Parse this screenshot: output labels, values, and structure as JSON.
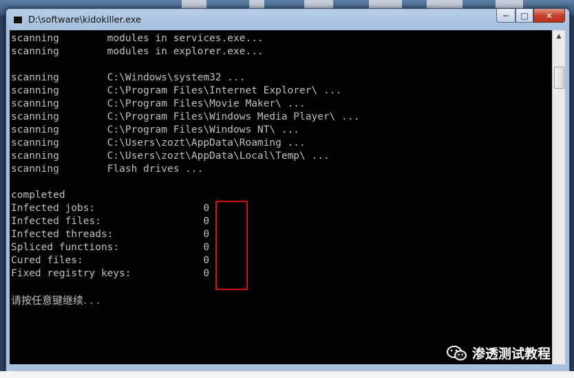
{
  "window": {
    "title": "D:\\software\\kidokiller.exe",
    "controls": {
      "minimize": "─",
      "maximize": "□",
      "close": "✕"
    }
  },
  "console": {
    "lines": [
      "scanning        modules in services.exe...",
      "scanning        modules in explorer.exe...",
      "",
      "scanning        C:\\Windows\\system32 ...",
      "scanning        C:\\Program Files\\Internet Explorer\\ ...",
      "scanning        C:\\Program Files\\Movie Maker\\ ...",
      "scanning        C:\\Program Files\\Windows Media Player\\ ...",
      "scanning        C:\\Program Files\\Windows NT\\ ...",
      "scanning        C:\\Users\\zozt\\AppData\\Roaming ...",
      "scanning        C:\\Users\\zozt\\AppData\\Local\\Temp\\ ...",
      "scanning        Flash drives ...",
      "",
      "completed",
      "Infected jobs:                  0",
      "Infected files:                 0",
      "Infected threads:               0",
      "Spliced functions:              0",
      "Cured files:                    0",
      "Fixed registry keys:            0",
      "",
      "请按任意键继续. . ."
    ]
  },
  "watermark": {
    "text": "渗透测试教程"
  },
  "colors": {
    "console_bg": "#000000",
    "console_fg": "#c0c0c0",
    "highlight": "#d01414"
  }
}
